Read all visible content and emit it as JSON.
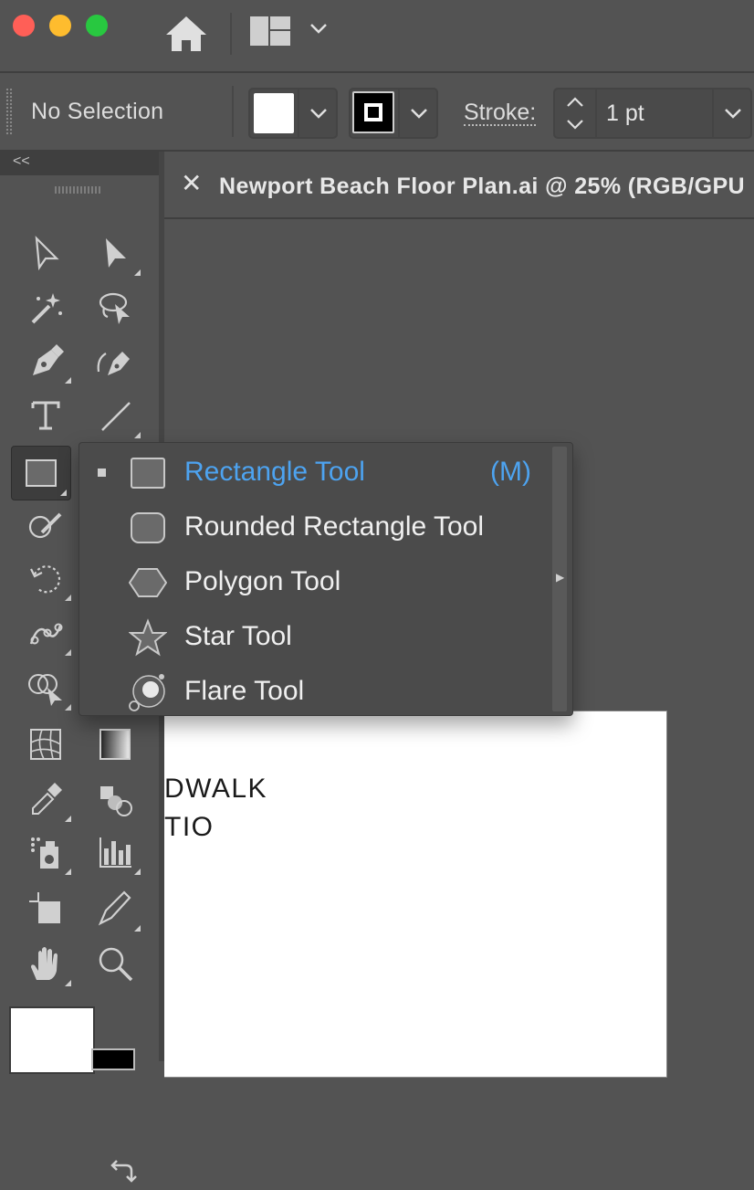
{
  "titlebar": {
    "traffic_lights": {
      "close": "#ff5f57",
      "minimize": "#febc2e",
      "maximize": "#28c840"
    },
    "home_icon": "home-icon",
    "workspace_icon": "workspace-layout-icon"
  },
  "control_bar": {
    "selection_status": "No Selection",
    "fill_color": "#ffffff",
    "stroke_color": "#000000",
    "stroke_label": "Stroke:",
    "stroke_weight": "1 pt"
  },
  "document": {
    "tab_title": "Newport Beach Floor Plan.ai @ 25% (RGB/GPU",
    "artboard_text": [
      "DWALK",
      "TIO"
    ]
  },
  "flyout": {
    "items": [
      {
        "label": "Rectangle Tool",
        "shortcut": "(M)",
        "icon": "rectangle-icon",
        "selected": true
      },
      {
        "label": "Rounded Rectangle Tool",
        "shortcut": "",
        "icon": "rounded-rectangle-icon",
        "selected": false
      },
      {
        "label": "Polygon Tool",
        "shortcut": "",
        "icon": "polygon-icon",
        "selected": false
      },
      {
        "label": "Star Tool",
        "shortcut": "",
        "icon": "star-icon",
        "selected": false
      },
      {
        "label": "Flare Tool",
        "shortcut": "",
        "icon": "flare-icon",
        "selected": false
      }
    ]
  },
  "toolbar": {
    "collapse_label": "<<",
    "tools": [
      "selection",
      "direct-selection",
      "magic-wand",
      "lasso",
      "pen",
      "curvature",
      "type",
      "line-segment",
      "rectangle",
      "shaper",
      "rotate",
      "puppet-warp",
      "shape-builder",
      "mesh",
      "gradient",
      "eyedropper",
      "blend",
      "symbol-sprayer",
      "column-graph",
      "artboard",
      "slice",
      "hand",
      "zoom"
    ],
    "fill_color": "#ffffff",
    "stroke_color": "#000000"
  },
  "colors": {
    "accent": "#4da3f0",
    "panel": "#535353",
    "dark": "#3f3f3f"
  }
}
